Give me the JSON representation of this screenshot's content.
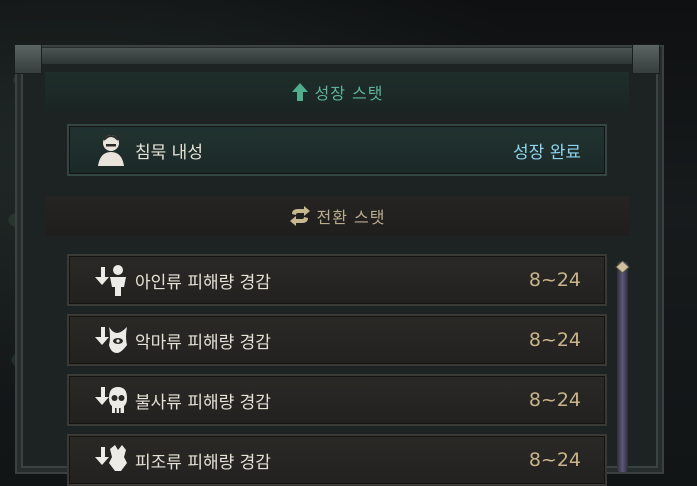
{
  "growth_section": {
    "title": "성장 스탯",
    "row": {
      "label": "침묵 내성",
      "value": "성장 완료",
      "icon": "silence-resist-icon"
    }
  },
  "switch_section": {
    "title": "전환 스탯",
    "rows": [
      {
        "label": "아인류 피해량 경감",
        "value": "8~24",
        "icon": "humanoid-icon"
      },
      {
        "label": "악마류 피해량 경감",
        "value": "8~24",
        "icon": "demon-icon"
      },
      {
        "label": "불사류 피해량 경감",
        "value": "8~24",
        "icon": "undead-icon"
      },
      {
        "label": "피조류 피해량 경감",
        "value": "8~24",
        "icon": "construct-icon"
      }
    ]
  },
  "colors": {
    "growth_accent": "#5fb39a",
    "switch_accent": "#b9ad8e",
    "value_text": "#c8b48a",
    "complete_text": "#8fd3ee"
  }
}
